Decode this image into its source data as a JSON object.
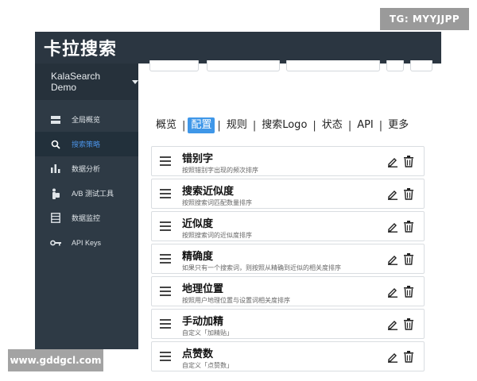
{
  "app": {
    "title": "卡拉搜索"
  },
  "workspace": {
    "name": "KalaSearch Demo"
  },
  "sidebar": {
    "items": [
      {
        "label": "全局概览",
        "icon": "overview-icon",
        "active": false
      },
      {
        "label": "搜索策略",
        "icon": "search-icon",
        "active": true
      },
      {
        "label": "数据分析",
        "icon": "bar-chart-icon",
        "active": false
      },
      {
        "label": "A/B 测试工具",
        "icon": "ab-test-icon",
        "active": false
      },
      {
        "label": "数据监控",
        "icon": "monitor-icon",
        "active": false
      },
      {
        "label": "API Keys",
        "icon": "key-icon",
        "active": false
      }
    ]
  },
  "tabs": [
    {
      "label": "概览",
      "active": false
    },
    {
      "label": "配置",
      "active": true
    },
    {
      "label": "规则",
      "active": false
    },
    {
      "label": "搜索Logo",
      "active": false
    },
    {
      "label": "状态",
      "active": false
    },
    {
      "label": "API",
      "active": false
    },
    {
      "label": "更多",
      "active": false
    }
  ],
  "rules": [
    {
      "title": "错别字",
      "desc": "按照错别字出现的频次排序"
    },
    {
      "title": "搜索近似度",
      "desc": "按照搜索词匹配数量排序"
    },
    {
      "title": "近似度",
      "desc": "按照搜索词的近似度排序"
    },
    {
      "title": "精确度",
      "desc": "如果只有一个搜索词，则按照从精确到近似的相关度排序"
    },
    {
      "title": "地理位置",
      "desc": "按照用户地理位置与设置词相关度排序"
    },
    {
      "title": "手动加精",
      "desc": "自定义「加精贴」"
    },
    {
      "title": "点赞数",
      "desc": "自定义「点赞数」"
    }
  ],
  "watermarks": {
    "top": "TG: MYYJJPP",
    "bottom": "www.gddgcl.com"
  },
  "colors": {
    "header": "#2b3641",
    "sidebar": "#2e3a45",
    "accent": "#3f97e8"
  }
}
